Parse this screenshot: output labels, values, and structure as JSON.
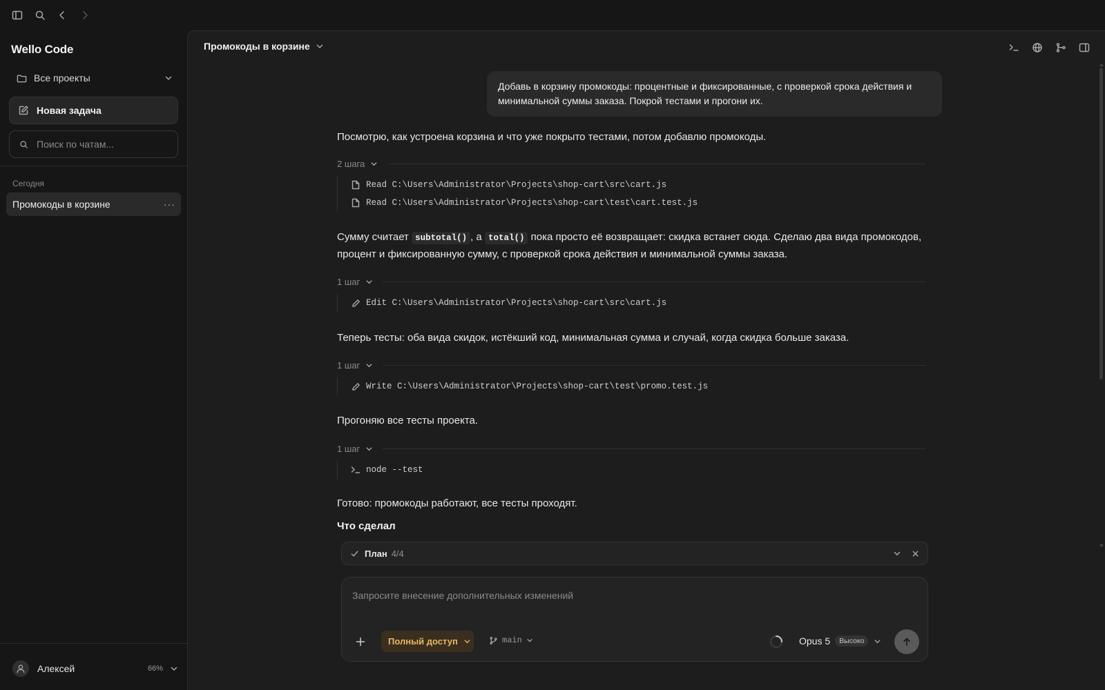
{
  "sidebar": {
    "brand": "Wello Code",
    "project_select": "Все проекты",
    "new_task": "Новая задача",
    "search_placeholder": "Поиск по чатам...",
    "section_today": "Сегодня",
    "chats": [
      {
        "label": "Промокоды в корзине",
        "more": "···"
      }
    ],
    "user": {
      "name": "Алексей",
      "usage": "66%"
    }
  },
  "main": {
    "chat_title": "Промокоды в корзине",
    "user_message": "Добавь в корзину промокоды: процентные и фиксированные, с проверкой срока действия и минимальной суммы заказа. Покрой тестами и прогони их.",
    "messages": {
      "m1": "Посмотрю, как устроена корзина и что уже покрыто тестами, потом добавлю промокоды.",
      "m2_pre": "Сумму считает ",
      "m2_code1": "subtotal()",
      "m2_mid": ", а ",
      "m2_code2": "total()",
      "m2_post": " пока просто её возвращает: скидка встанет сюда. Сделаю два вида промокодов, процент и фиксированную сумму, с проверкой срока действия и минимальной суммы заказа.",
      "m3": "Теперь тесты: оба вида скидок, истёкший код, минимальная сумма и случай, когда скидка больше заказа.",
      "m4": "Прогоняю все тесты проекта.",
      "m5": "Готово: промокоды работают, все тесты проходят.",
      "done_heading": "Что сделал"
    },
    "step_groups": [
      {
        "label": "2 шага",
        "steps": [
          {
            "icon": "file-icon",
            "text": "Read C:\\Users\\Administrator\\Projects\\shop-cart\\src\\cart.js"
          },
          {
            "icon": "file-icon",
            "text": "Read C:\\Users\\Administrator\\Projects\\shop-cart\\test\\cart.test.js"
          }
        ]
      },
      {
        "label": "1 шаг",
        "steps": [
          {
            "icon": "pencil-icon",
            "text": "Edit C:\\Users\\Administrator\\Projects\\shop-cart\\src\\cart.js"
          }
        ]
      },
      {
        "label": "1 шаг",
        "steps": [
          {
            "icon": "pencil-icon",
            "text": "Write C:\\Users\\Administrator\\Projects\\shop-cart\\test\\promo.test.js"
          }
        ]
      },
      {
        "label": "1 шаг",
        "steps": [
          {
            "icon": "terminal-icon",
            "text": "node --test"
          }
        ]
      }
    ],
    "plan": {
      "label": "План",
      "count": "4/4"
    },
    "composer": {
      "placeholder": "Запросите внесение дополнительных изменений",
      "access": "Полный доступ",
      "branch": "main",
      "model": "Opus 5",
      "effort": "Высоко"
    }
  },
  "colors": {
    "background": "#161616",
    "panel": "#1d1d1d",
    "access_accent": "#e7b766"
  }
}
